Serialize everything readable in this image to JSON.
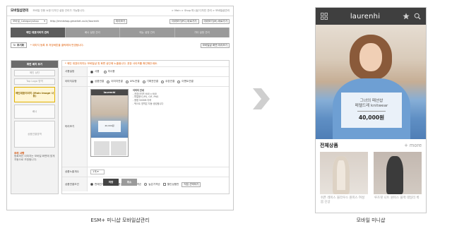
{
  "admin": {
    "title": "모바일샵관리",
    "subtitle": "모바일 전용 쇼핑 디자인 설정 관리가 가능합니다.",
    "breadcrumb": "> Main > Shop 미니샵 디자인 관리 > 모바일샵관리",
    "url_select": "모바일_Categoryshop",
    "url_text": "http://minishop.gmarket.co.kr/laurenhi",
    "url_button": "미리보기",
    "top_right_buttons": [
      "미리보기(PC) 바로가기",
      "미리보기(M) 바로가기"
    ],
    "tabs": [
      "메인 대표이미지 관리",
      "배너 설정 관리",
      "메뉴 설정 관리",
      "기타 설정 관리"
    ],
    "reset_label": "초기화",
    "notice": "* 이미지 등록 후 저장버튼을 클릭해야 반영됩니다.",
    "bar_right_button": "모바일샵 화면 미리보기",
    "side": {
      "header": "화면 배치 보기",
      "slots": [
        "메인 상단",
        "Top Logo 영역",
        "메인대표이미지 (Main image 사용)",
        "배너",
        "상품진열영역"
      ],
      "note_title": "주의 사항",
      "note_text": "등록하신 이미지는 모바일 화면에 맞게 자동으로 조정됩니다."
    },
    "form": {
      "warning": "* 메인 대표이미지는 모바일샵 첫 화면 상단에 노출됩니다. 권장 사이즈를 확인해주세요.",
      "row_use": {
        "label": "사용설정",
        "options": [
          "사용",
          "미사용"
        ]
      },
      "row_type": {
        "label": "이미지유형",
        "options": [
          "상품연결",
          "이미지연결",
          "URL연결",
          "기획전연결",
          "쿠폰연결",
          "이벤트연결"
        ]
      },
      "row_preview": {
        "label": "미리보기",
        "phone_logo": "laurenhi",
        "phone_card": "40,000원",
        "guide_title": "이미지 안내",
        "guide_lines": [
          "- 권장사이즈 640 x 640",
          "- 파일형식 JPG, GIF, PNG",
          "- 용량 500KB 이하",
          "- 텍스트 영역은 자동 생성됩니다"
        ]
      },
      "row_count": {
        "label": "상품노출개수",
        "value": "1개"
      },
      "row_cond": {
        "label": "상품연결조건",
        "options": [
          "판매인기순",
          "신상품순",
          "낮은가격순",
          "높은가격순"
        ],
        "check": "할인상품만",
        "button": "직접 선택하기"
      }
    },
    "save": "저장",
    "cancel": "취소"
  },
  "mobile": {
    "logo": "laurenhi",
    "hero_line1": "그녀의 패션샵",
    "hero_line2": "메렐드레 knitwear",
    "hero_price": "40,000원",
    "section_title": "전체상품",
    "more": "+ more",
    "items": [
      {
        "desc": "쉬폰 레이스 블라우스 원피스 여성 봄 신상"
      },
      {
        "desc": "루즈핏 니트 원피스 블랙 데일리 룩"
      }
    ]
  },
  "captions": {
    "left": "ESM+ 미니샵 모바일샵관리",
    "right": "모바일 미니샵"
  },
  "colors": {
    "accent_orange": "#e05a00",
    "tab_active": "#5c5c5c",
    "mobile_header": "#3f3f3f"
  },
  "icons": [
    "grid-icon",
    "star-icon",
    "search-icon",
    "chevron-right-icon"
  ]
}
